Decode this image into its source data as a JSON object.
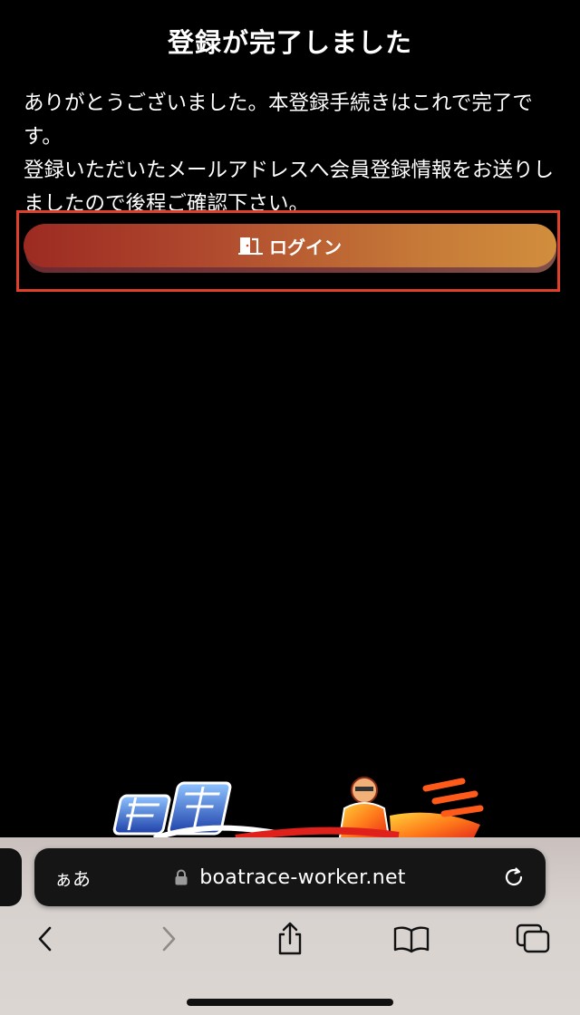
{
  "page": {
    "title": "登録が完了しました",
    "message_lines": [
      "ありがとうございました。本登録手続きはこれで完了です。",
      "登録いただいたメールアドレスへ会員登録情報をお送りしましたので後程ご確認下さい。"
    ],
    "login_label": "ログイン",
    "login_icon": "door-exit-icon",
    "logo_alt": "競艇"
  },
  "browser": {
    "aa_label": "ぁあ",
    "url": "boatrace-worker.net",
    "icons": {
      "lock": "lock-icon",
      "reload": "reload-icon",
      "back": "chevron-left-icon",
      "forward": "chevron-right-icon",
      "share": "share-icon",
      "bookmarks": "book-icon",
      "tabs": "tabs-icon"
    }
  },
  "colors": {
    "highlight": "#e0402a",
    "button_start": "#9c2a22",
    "button_end": "#d18e3c"
  }
}
